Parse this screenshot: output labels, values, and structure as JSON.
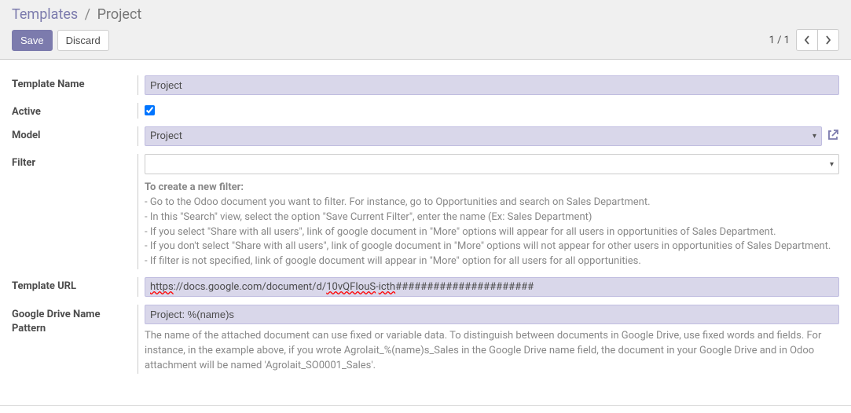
{
  "breadcrumb": {
    "root": "Templates",
    "current": "Project"
  },
  "toolbar": {
    "save": "Save",
    "discard": "Discard",
    "pager": "1 / 1"
  },
  "labels": {
    "template_name": "Template Name",
    "active": "Active",
    "model": "Model",
    "filter": "Filter",
    "template_url": "Template URL",
    "gdrive_name_pattern": "Google Drive Name Pattern"
  },
  "values": {
    "template_name": "Project",
    "model": "Project",
    "template_url_prefix": "https",
    "template_url_mid": "://docs.google.com/document/d/",
    "template_url_id": "10vQFIouS",
    "template_url_dash": "-",
    "template_url_id2": "icth",
    "template_url_hash": "######################",
    "gdrive_name_pattern": "Project: %(name)s",
    "active": true
  },
  "filter_help": {
    "title": "To create a new filter:",
    "line1": "- Go to the Odoo document you want to filter. For instance, go to Opportunities and search on Sales Department.",
    "line2": "- In this \"Search\" view, select the option \"Save Current Filter\", enter the name (Ex: Sales Department)",
    "line3": "- If you select \"Share with all users\", link of google document in \"More\" options will appear for all users in opportunities of Sales Department.",
    "line4": "- If you don't select \"Share with all users\", link of google document in \"More\" options will not appear for other users in opportunities of Sales Department.",
    "line5": "- If filter is not specified, link of google document will appear in \"More\" option for all users for all opportunities."
  },
  "gdrive_help": "The name of the attached document can use fixed or variable data. To distinguish between documents in Google Drive, use fixed words and fields. For instance, in the example above, if you wrote Agrolait_%(name)s_Sales in the Google Drive name field, the document in your Google Drive and in Odoo attachment will be named 'Agrolait_SO0001_Sales'."
}
